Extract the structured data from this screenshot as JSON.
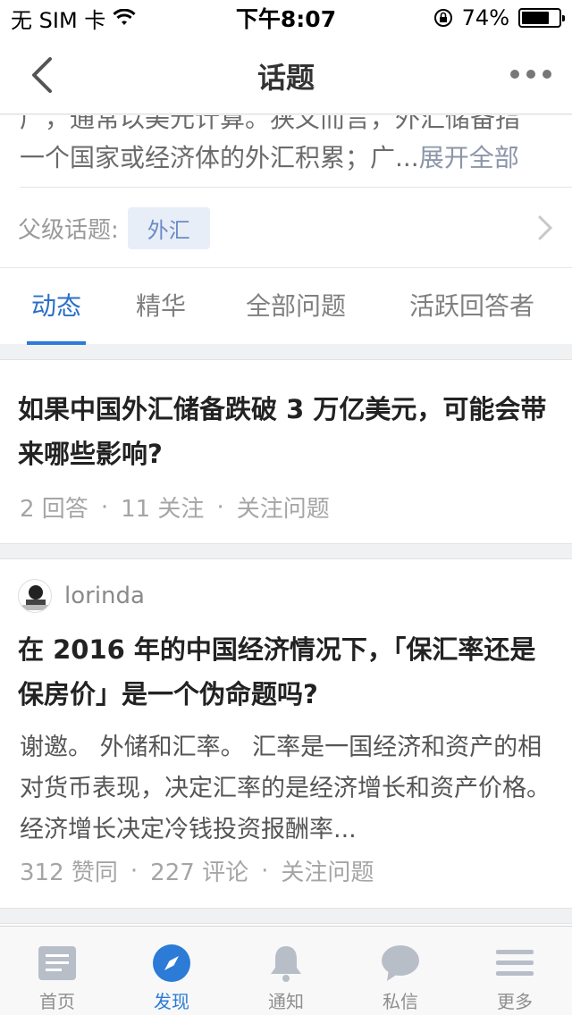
{
  "status_bar": {
    "carrier": "无 SIM 卡",
    "time": "下午8:07",
    "battery_pct": "74%",
    "battery_level": 0.74
  },
  "nav": {
    "title": "话题",
    "back_icon": "chevron-left-icon",
    "more_icon": "more-dots-icon"
  },
  "topic": {
    "intro_line1": "广，通常以美元计算。狭义而言，外汇储备指",
    "intro_line2": "一个国家或经济体的外汇积累；广...",
    "expand_label": "展开全部",
    "parent_label": "父级话题:",
    "parent_tag": "外汇"
  },
  "tabs": [
    {
      "label": "动态",
      "active": true
    },
    {
      "label": "精华",
      "active": false
    },
    {
      "label": "全部问题",
      "active": false
    },
    {
      "label": "活跃回答者",
      "active": false
    }
  ],
  "feed": [
    {
      "title": "如果中国外汇储备跌破 3 万亿美元，可能会带来哪些影响?",
      "answers": "2 回答",
      "follows": "11 关注",
      "action": "关注问题"
    },
    {
      "author": "lorinda",
      "title": "在 2016 年的中国经济情况下，「保汇率还是保房价」是一个伪命题吗?",
      "excerpt": "谢邀。 外储和汇率。 汇率是一国经济和资产的相对货币表现，决定汇率的是经济增长和资产价格。经济增长决定冷钱投资报酬率...",
      "likes": "312 赞同",
      "comments": "227 评论",
      "action": "关注问题"
    }
  ],
  "tabbar": [
    {
      "label": "首页",
      "icon": "home-icon",
      "active": false
    },
    {
      "label": "发现",
      "icon": "compass-icon",
      "active": true
    },
    {
      "label": "通知",
      "icon": "bell-icon",
      "active": false
    },
    {
      "label": "私信",
      "icon": "chat-bubble-icon",
      "active": false
    },
    {
      "label": "更多",
      "icon": "menu-icon",
      "active": false
    }
  ],
  "colors": {
    "accent": "#2b7bd7",
    "tag_bg": "#e8eef8",
    "icon_gray": "#b8bec8"
  }
}
